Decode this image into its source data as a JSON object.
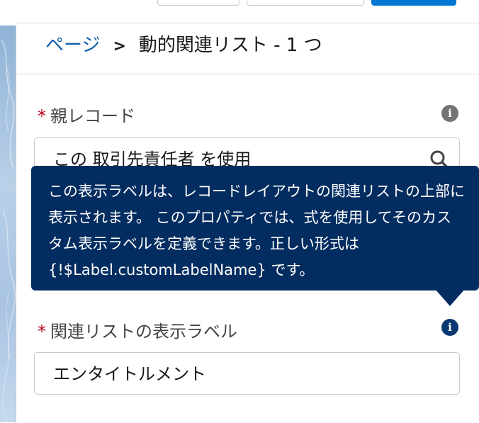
{
  "breadcrumb": {
    "parent": "ページ",
    "separator": ">",
    "current": "動的関連リスト - 1 つ"
  },
  "parent_record": {
    "label": "親レコード",
    "required_mark": "*",
    "value": "この 取引先責任者 を使用",
    "icon": "search-icon"
  },
  "tooltip": {
    "text": "この表示ラベルは、レコードレイアウトの関連リストの上部に表示されます。 このプロパティでは、式を使用してそのカスタム表示ラベルを定義できます。正しい形式は {!$Label.customLabelName} です。"
  },
  "related_list_label": {
    "label": "関連リストの表示ラベル",
    "required_mark": "*",
    "value": "エンタイトルメント"
  },
  "info_icon_glyph": "i",
  "colors": {
    "tooltip_bg": "#032d60",
    "link": "#0b5cab",
    "required": "#ba0517",
    "brand": "#0176d3"
  }
}
